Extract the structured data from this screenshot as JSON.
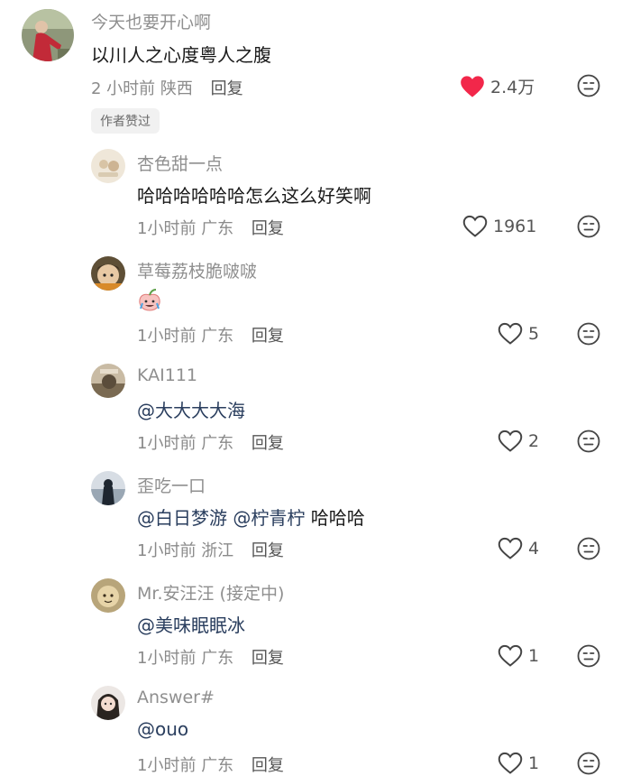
{
  "comments": [
    {
      "user": "今天也要开心啊",
      "text": "以川人之心度粤人之腹",
      "time": "2 小时前",
      "location": "陕西",
      "reply": "回复",
      "likes": "2.4万",
      "liked": true,
      "badge": "作者赞过",
      "avatar_color": "#7f8a6f",
      "replies": [
        {
          "user": "杏色甜一点",
          "text": "哈哈哈哈哈哈怎么这么好笑啊",
          "time": "1小时前",
          "location": "广东",
          "reply": "回复",
          "likes": "1961",
          "avatar_color": "#efe6d8"
        },
        {
          "user": "草莓荔枝脆啵啵",
          "sticker": "peach-sticker-icon",
          "time": "1小时前",
          "location": "广东",
          "reply": "回复",
          "likes": "5",
          "avatar_color": "#6a5a3e"
        },
        {
          "user": "KAI111",
          "text": "@大大大大海",
          "time": "1小时前",
          "location": "广东",
          "reply": "回复",
          "likes": "2",
          "avatar_color": "#8c7a62"
        },
        {
          "user": "歪吃一口",
          "text_parts": [
            "@白日梦游",
            " ",
            "@柠青柠",
            " 哈哈哈"
          ],
          "time": "1小时前",
          "location": "浙江",
          "reply": "回复",
          "likes": "4",
          "avatar_color": "#3c4a5a"
        },
        {
          "user": "Mr.安汪汪 (接定中)",
          "text": "@美味眠眠冰",
          "time": "1小时前",
          "location": "广东",
          "reply": "回复",
          "likes": "1",
          "avatar_color": "#a89868"
        },
        {
          "user": "Answer#",
          "text": "@ouo",
          "time": "1小时前",
          "location": "广东",
          "reply": "回复",
          "likes": "1",
          "avatar_color": "#d9d2cf"
        }
      ]
    }
  ],
  "colors": {
    "like_red": "#f2274a",
    "mention_blue": "#2a3e5e",
    "meta_gray": "#8a8a8a"
  }
}
